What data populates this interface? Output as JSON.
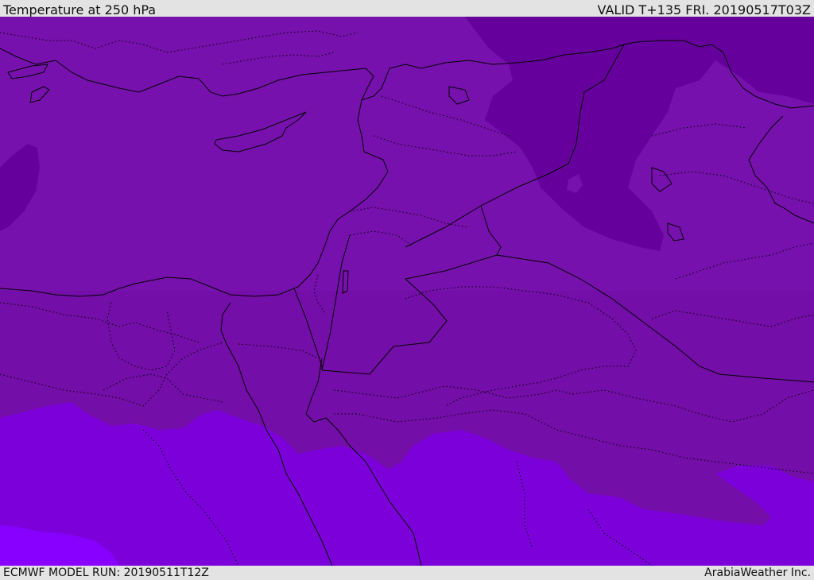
{
  "header": {
    "title": "Temperature at 250 hPa",
    "valid": "VALID T+135 FRI. 20190517T03Z"
  },
  "footer": {
    "model_run": "ECMWF MODEL RUN: 20190511T12Z",
    "credit": "ArabiaWeather Inc."
  },
  "colors": {
    "base": "#7711ae",
    "cold": "#66009c",
    "mid": "#740ea8",
    "warm": "#7c00da",
    "warmest": "#8800ff",
    "boundary": "#000000"
  }
}
